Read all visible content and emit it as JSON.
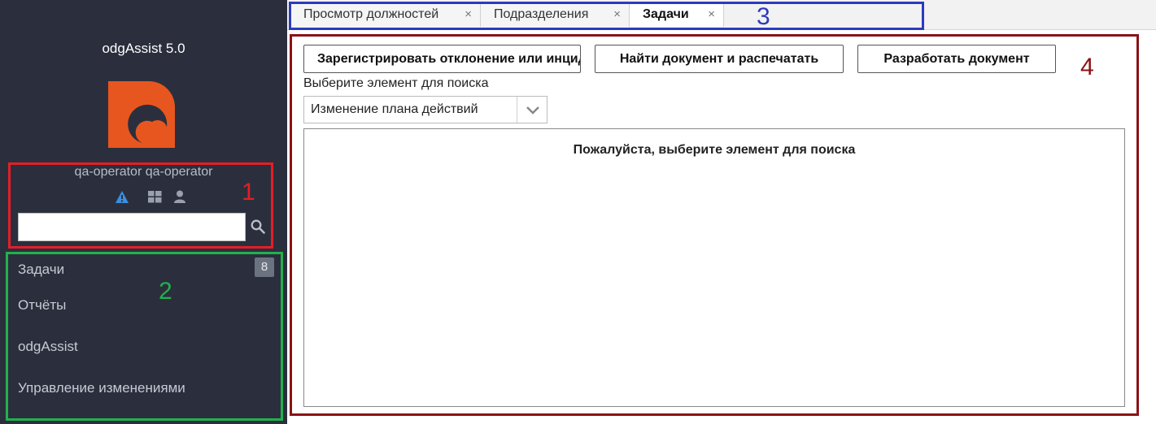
{
  "sidebar": {
    "app_name": "odgAssist 5.0",
    "username": "qa-operator qa-operator",
    "icons": [
      "warning-icon",
      "dashboard-icon",
      "user-icon"
    ],
    "search": {
      "value": "",
      "placeholder": ""
    },
    "nav": [
      {
        "label": "Задачи",
        "badge": "8"
      },
      {
        "label": "Отчёты"
      },
      {
        "label": "odgAssist"
      },
      {
        "label": "Управление изменениями"
      }
    ],
    "colors": {
      "bg": "#2b2f3d",
      "logo": "#e8561f"
    }
  },
  "tabs": [
    {
      "label": "Просмотр должностей",
      "close": "×"
    },
    {
      "label": "Подразделения",
      "close": "×"
    },
    {
      "label": "Задачи",
      "close": "×",
      "active": true
    }
  ],
  "toolbar": {
    "register_label": "Зарегистрировать отклонение или инцидент",
    "find_label": "Найти документ и распечатать",
    "develop_label": "Разработать документ"
  },
  "search_select": {
    "label": "Выберите элемент для поиска",
    "selected": "Изменение плана действий"
  },
  "result": {
    "message": "Пожалуйста, выберите элемент для поиска"
  },
  "annotations": {
    "one": "1",
    "two": "2",
    "three": "3",
    "four": "4"
  },
  "annotation_colors": {
    "one": "#e51e25",
    "two": "#22b14c",
    "three": "#2c3bbd",
    "four": "#8b1216"
  }
}
